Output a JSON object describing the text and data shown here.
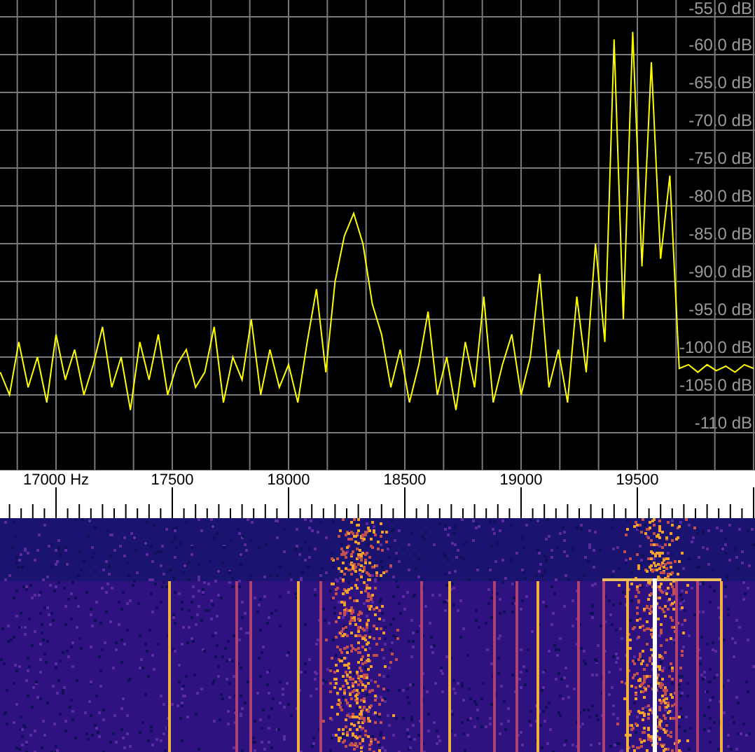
{
  "spectrum": {
    "chart_data": {
      "type": "line",
      "xlim": [
        16759,
        20006
      ],
      "ylim": [
        -115,
        -52.78
      ],
      "grid": true,
      "x": [
        16760,
        16800,
        16840,
        16880,
        16920,
        16960,
        17000,
        17040,
        17080,
        17120,
        17160,
        17200,
        17240,
        17280,
        17320,
        17360,
        17400,
        17440,
        17480,
        17520,
        17560,
        17600,
        17640,
        17680,
        17720,
        17760,
        17800,
        17840,
        17880,
        17920,
        17960,
        18000,
        18040,
        18080,
        18120,
        18160,
        18200,
        18240,
        18280,
        18320,
        18360,
        18400,
        18440,
        18480,
        18520,
        18560,
        18600,
        18640,
        18680,
        18720,
        18760,
        18800,
        18840,
        18880,
        18920,
        18960,
        19000,
        19040,
        19080,
        19120,
        19160,
        19200,
        19240,
        19280,
        19320,
        19360,
        19400,
        19440,
        19480,
        19520,
        19560,
        19600,
        19640,
        19680,
        19720,
        19760,
        19800,
        19840,
        19880,
        19920,
        19960,
        20000
      ],
      "series": [
        {
          "color": "#ffff00",
          "values": [
            -102,
            -105,
            -98,
            -104,
            -100,
            -106,
            -97,
            -103,
            -99,
            -105,
            -101,
            -96,
            -104,
            -100,
            -107,
            -98,
            -103,
            -97,
            -105,
            -101,
            -99,
            -104,
            -102,
            -96,
            -106,
            -100,
            -103,
            -95,
            -105,
            -99,
            -104,
            -101,
            -106,
            -98,
            -91,
            -102,
            -90,
            -84,
            -81,
            -85,
            -93,
            -97,
            -104,
            -99,
            -106,
            -101,
            -94,
            -105,
            -100,
            -107,
            -98,
            -104,
            -92,
            -106,
            -101,
            -97,
            -105,
            -100,
            -89,
            -104,
            -99,
            -106,
            -92,
            -102,
            -85,
            -98,
            -58,
            -95,
            -57,
            -88,
            -61,
            -87,
            -76,
            -101.5,
            -101,
            -102,
            -101,
            -101.8,
            -101.2,
            -102,
            -101,
            -101.5
          ]
        }
      ],
      "xticks": [
        {
          "value": 17000,
          "label": "17000 Hz"
        },
        {
          "value": 17500,
          "label": "17500"
        },
        {
          "value": 18000,
          "label": "18000"
        },
        {
          "value": 18500,
          "label": "18500"
        },
        {
          "value": 19000,
          "label": "19000"
        },
        {
          "value": 19500,
          "label": "19500"
        }
      ],
      "yticks": [
        {
          "value": -55,
          "label": "-55.0 dB"
        },
        {
          "value": -60,
          "label": "-60.0 dB"
        },
        {
          "value": -65,
          "label": "-65.0 dB"
        },
        {
          "value": -70,
          "label": "-70.0 dB"
        },
        {
          "value": -75,
          "label": "-75.0 dB"
        },
        {
          "value": -80,
          "label": "-80.0 dB"
        },
        {
          "value": -85,
          "label": "-85.0 dB"
        },
        {
          "value": -90,
          "label": "-90.0 dB"
        },
        {
          "value": -95,
          "label": "-95.0 dB"
        },
        {
          "value": -100,
          "label": "-100.0 dB"
        },
        {
          "value": -105,
          "label": "-105.0 dB"
        },
        {
          "value": -110,
          "label": "-110 dB"
        }
      ]
    }
  }
}
